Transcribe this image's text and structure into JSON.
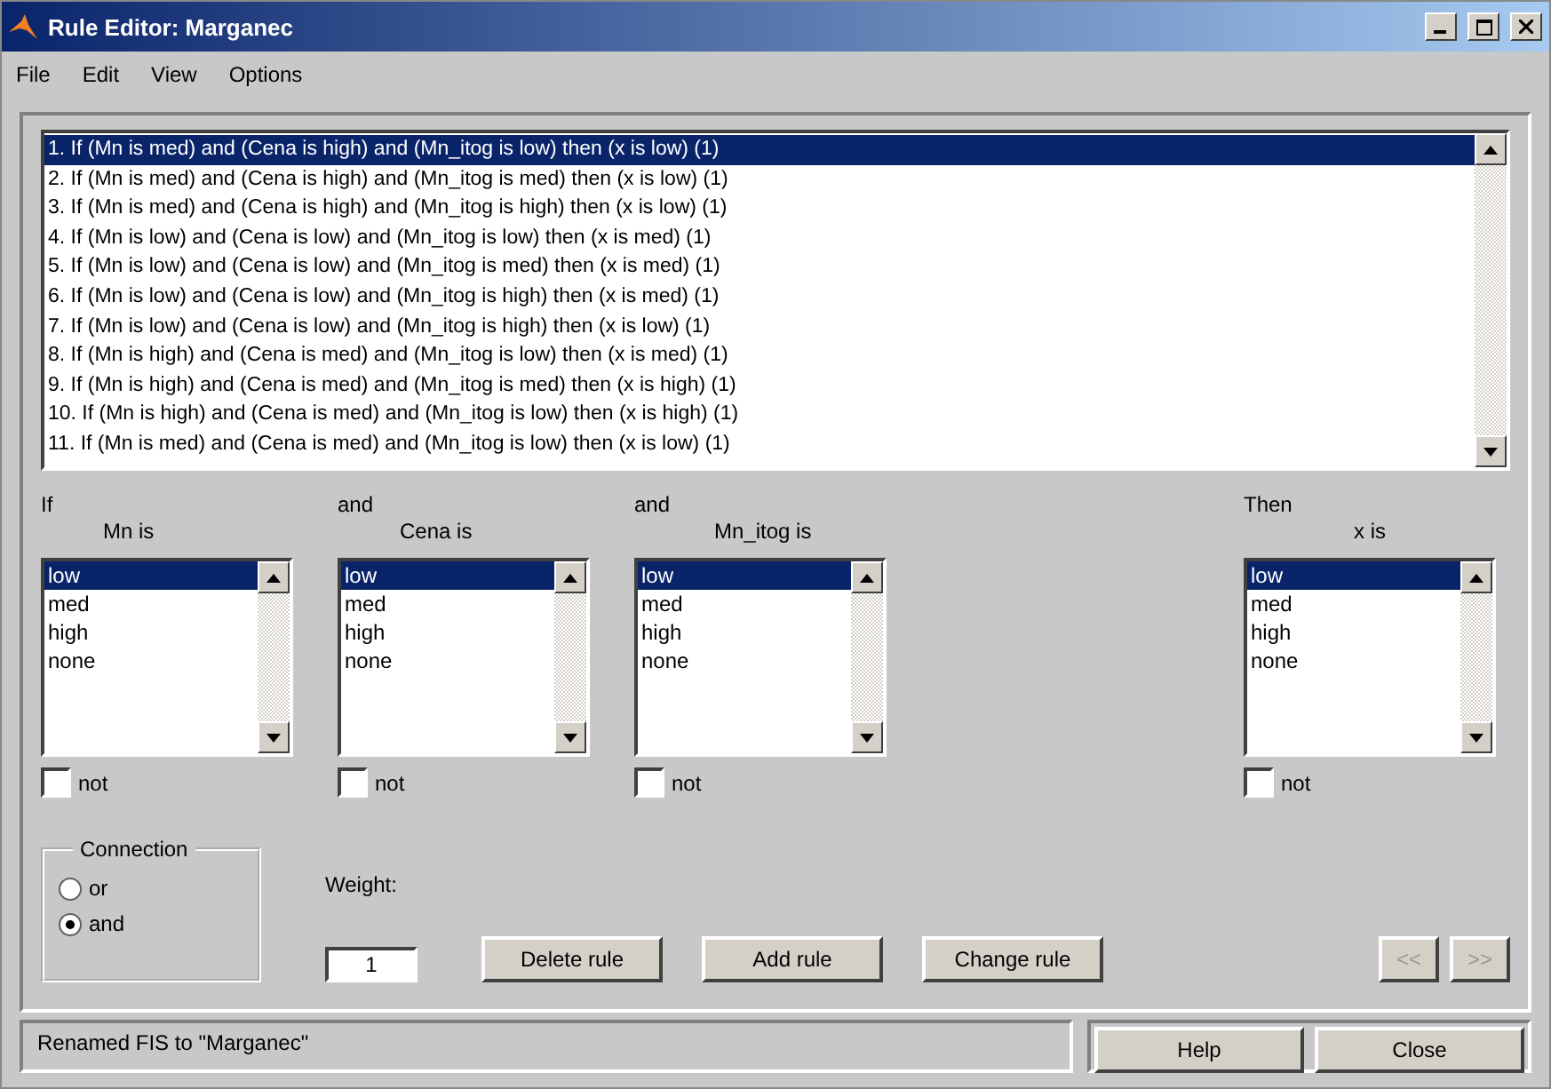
{
  "window": {
    "title": "Rule Editor: Marganec"
  },
  "menu": [
    "File",
    "Edit",
    "View",
    "Options"
  ],
  "rules": [
    {
      "text": "1. If (Mn is med) and (Cena is high) and (Mn_itog is low) then (x is low) (1)",
      "selected": true
    },
    {
      "text": "2. If (Mn is med) and (Cena is high) and (Mn_itog is med) then (x is low) (1)",
      "selected": false
    },
    {
      "text": "3. If (Mn is med) and (Cena is high) and (Mn_itog is high) then (x is low) (1)",
      "selected": false
    },
    {
      "text": "4. If (Mn is low) and (Cena is low) and (Mn_itog is low) then (x is med) (1)",
      "selected": false
    },
    {
      "text": "5. If (Mn is low) and (Cena is low) and (Mn_itog is med) then (x is med) (1)",
      "selected": false
    },
    {
      "text": "6. If (Mn is low) and (Cena is low) and (Mn_itog is high) then (x is med) (1)",
      "selected": false
    },
    {
      "text": "7. If (Mn is low) and (Cena is low) and (Mn_itog is high) then (x is low) (1)",
      "selected": false
    },
    {
      "text": "8. If (Mn is high) and (Cena is med) and (Mn_itog is low) then (x is med) (1)",
      "selected": false
    },
    {
      "text": "9. If (Mn is high) and (Cena is med) and (Mn_itog is med) then (x is high) (1)",
      "selected": false
    },
    {
      "text": "10. If (Mn is high) and (Cena is med) and (Mn_itog is low) then (x is high) (1)",
      "selected": false
    },
    {
      "text": "11. If (Mn is med) and (Cena is med) and (Mn_itog is low) then (x is low) (1)",
      "selected": false
    }
  ],
  "variables": [
    {
      "connector": "If",
      "label": "Mn is",
      "not_label": "not",
      "not": false,
      "options": [
        {
          "label": "low",
          "selected": true
        },
        {
          "label": "med",
          "selected": false
        },
        {
          "label": "high",
          "selected": false
        },
        {
          "label": "none",
          "selected": false
        }
      ]
    },
    {
      "connector": "and",
      "label": "Cena is",
      "not_label": "not",
      "not": false,
      "options": [
        {
          "label": "low",
          "selected": true
        },
        {
          "label": "med",
          "selected": false
        },
        {
          "label": "high",
          "selected": false
        },
        {
          "label": "none",
          "selected": false
        }
      ]
    },
    {
      "connector": "and",
      "label": "Mn_itog is",
      "not_label": "not",
      "not": false,
      "options": [
        {
          "label": "low",
          "selected": true
        },
        {
          "label": "med",
          "selected": false
        },
        {
          "label": "high",
          "selected": false
        },
        {
          "label": "none",
          "selected": false
        }
      ]
    }
  ],
  "output": {
    "connector": "Then",
    "label": "x is",
    "not_label": "not",
    "not": false,
    "options": [
      {
        "label": "low",
        "selected": true
      },
      {
        "label": "med",
        "selected": false
      },
      {
        "label": "high",
        "selected": false
      },
      {
        "label": "none",
        "selected": false
      }
    ]
  },
  "connection": {
    "title": "Connection",
    "options": [
      {
        "label": "or",
        "selected": false
      },
      {
        "label": "and",
        "selected": true
      }
    ]
  },
  "weight": {
    "label": "Weight:",
    "value": "1"
  },
  "actions": [
    "Delete rule",
    "Add rule",
    "Change rule"
  ],
  "nav": [
    {
      "label": "<<",
      "disabled": true
    },
    {
      "label": ">>",
      "disabled": true
    }
  ],
  "status": "Renamed FIS to \"Marganec\"",
  "footer_buttons": [
    "Help",
    "Close"
  ]
}
